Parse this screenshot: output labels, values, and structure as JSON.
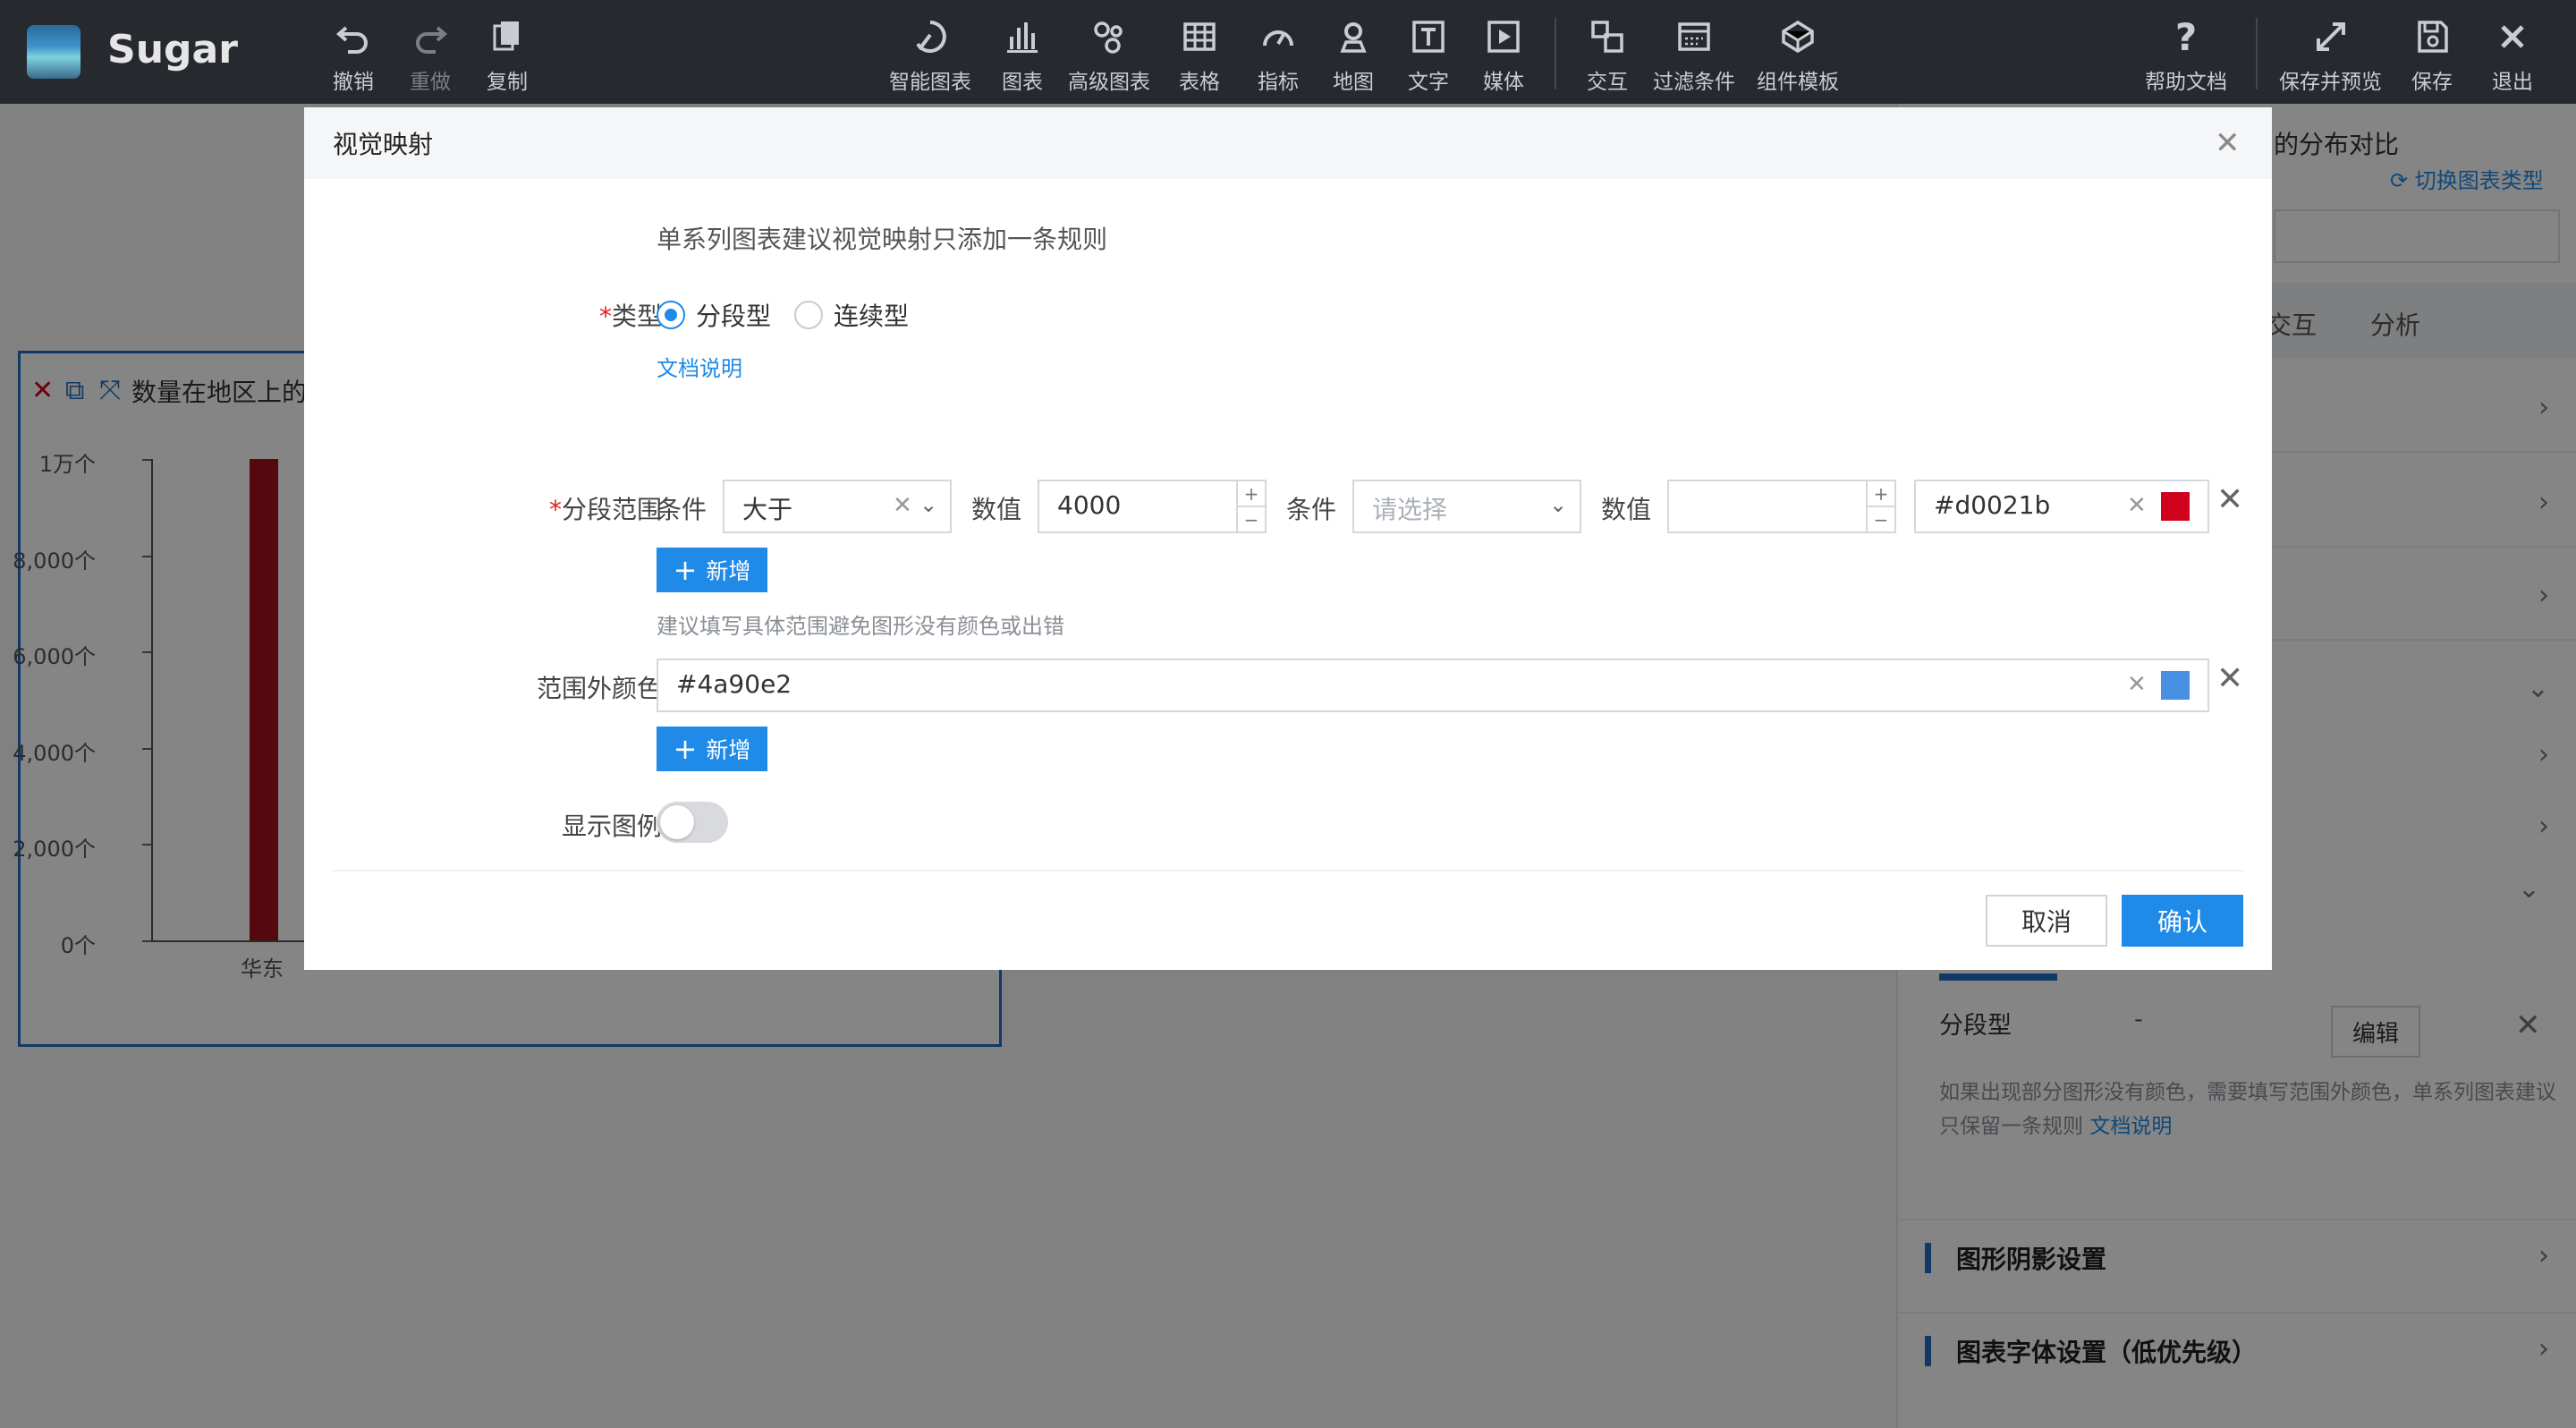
{
  "app": {
    "brand": "Sugar"
  },
  "toolbar": {
    "left": [
      {
        "label": "撤销",
        "icon": "undo-icon"
      },
      {
        "label": "重做",
        "icon": "redo-icon"
      },
      {
        "label": "复制",
        "icon": "copy-icon"
      }
    ],
    "center": [
      {
        "label": "智能图表",
        "icon": "smart-chart-icon"
      },
      {
        "label": "图表",
        "icon": "bar-chart-icon"
      },
      {
        "label": "高级图表",
        "icon": "advanced-chart-icon"
      },
      {
        "label": "表格",
        "icon": "table-icon"
      },
      {
        "label": "指标",
        "icon": "gauge-icon"
      },
      {
        "label": "地图",
        "icon": "map-icon"
      },
      {
        "label": "文字",
        "icon": "text-icon"
      },
      {
        "label": "媒体",
        "icon": "media-icon"
      },
      {
        "label": "交互",
        "icon": "interaction-icon"
      },
      {
        "label": "过滤条件",
        "icon": "filter-icon"
      },
      {
        "label": "组件模板",
        "icon": "component-template-icon"
      }
    ],
    "right": [
      {
        "label": "帮助文档",
        "icon": "help-icon"
      },
      {
        "label": "保存并预览",
        "icon": "expand-icon"
      },
      {
        "label": "保存",
        "icon": "save-icon"
      },
      {
        "label": "退出",
        "icon": "exit-icon"
      }
    ]
  },
  "chart_card": {
    "title": "数量在地区上的",
    "chart_data": {
      "type": "bar",
      "categories": [
        "华东"
      ],
      "values": [
        10000
      ],
      "ylim": [
        0,
        10000
      ],
      "yticks": [
        "0个",
        "2,000个",
        "4,000个",
        "6,000个",
        "8,000个",
        "1万个"
      ],
      "bar_color": "#a3101c"
    }
  },
  "right_panel": {
    "title": "的分布对比",
    "switch_label": "切换图表类型",
    "tabs": [
      "交互",
      "分析"
    ],
    "mapping_type": "分段型",
    "mapping_dash": "-",
    "edit_label": "编辑",
    "note": "如果出现部分图形没有颜色，需要填写范围外颜色，单系列图表建议只保留一条规则",
    "note_link": "文档说明",
    "sections": [
      "图形阴影设置",
      "图表字体设置（低优先级）"
    ]
  },
  "modal": {
    "title": "视觉映射",
    "hint": "单系列图表建议视觉映射只添加一条规则",
    "type_label": "类型",
    "type_options": [
      {
        "label": "分段型",
        "checked": true
      },
      {
        "label": "连续型",
        "checked": false
      }
    ],
    "doc_link": "文档说明",
    "range_label": "分段范围",
    "condition_label": "条件",
    "value_label": "数值",
    "condition1": "大于",
    "value1": "4000",
    "condition2_placeholder": "请选择",
    "value2": "",
    "range_color": "#d0021b",
    "add_label": "新增",
    "range_hint": "建议填写具体范围避免图形没有颜色或出错",
    "outside_label": "范围外颜色",
    "outside_color": "#4a90e2",
    "legend_label": "显示图例",
    "legend_on": false,
    "cancel_label": "取消",
    "ok_label": "确认",
    "accent": "#1f8ae8"
  }
}
